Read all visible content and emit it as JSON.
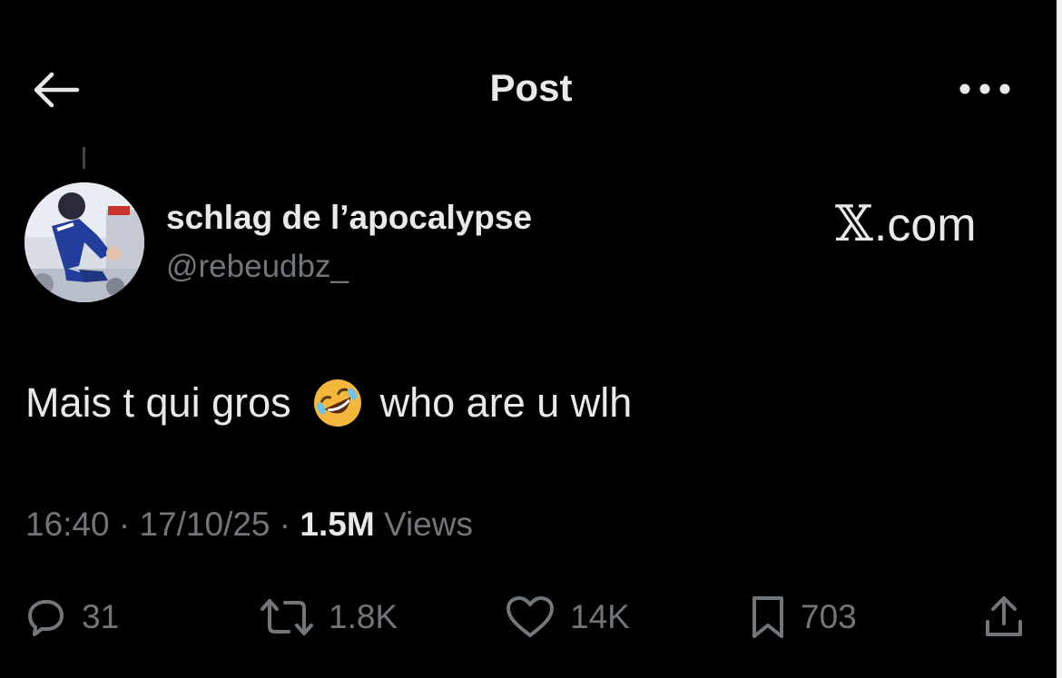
{
  "header": {
    "title": "Post",
    "back_icon": "arrow-left-icon",
    "more_icon": "more-horizontal-icon"
  },
  "author": {
    "display_name": "schlag de l’apocalypse",
    "handle": "@rebeudbz_"
  },
  "watermark": {
    "glyph": "𝕏",
    "text": ".com"
  },
  "post": {
    "text_before": "Mais t qui gros",
    "emoji": "rolling-on-floor-laughing-emoji",
    "text_after": "who are u wlh"
  },
  "meta": {
    "time": "16:40",
    "date": "17/10/25",
    "separator": "·",
    "views_count": "1.5M",
    "views_label": "Views"
  },
  "actions": {
    "replies": "31",
    "reposts": "1.8K",
    "likes": "14K",
    "bookmarks": "703"
  },
  "colors": {
    "background": "#000000",
    "text_primary": "#e7e9ea",
    "text_secondary": "#71767b"
  }
}
